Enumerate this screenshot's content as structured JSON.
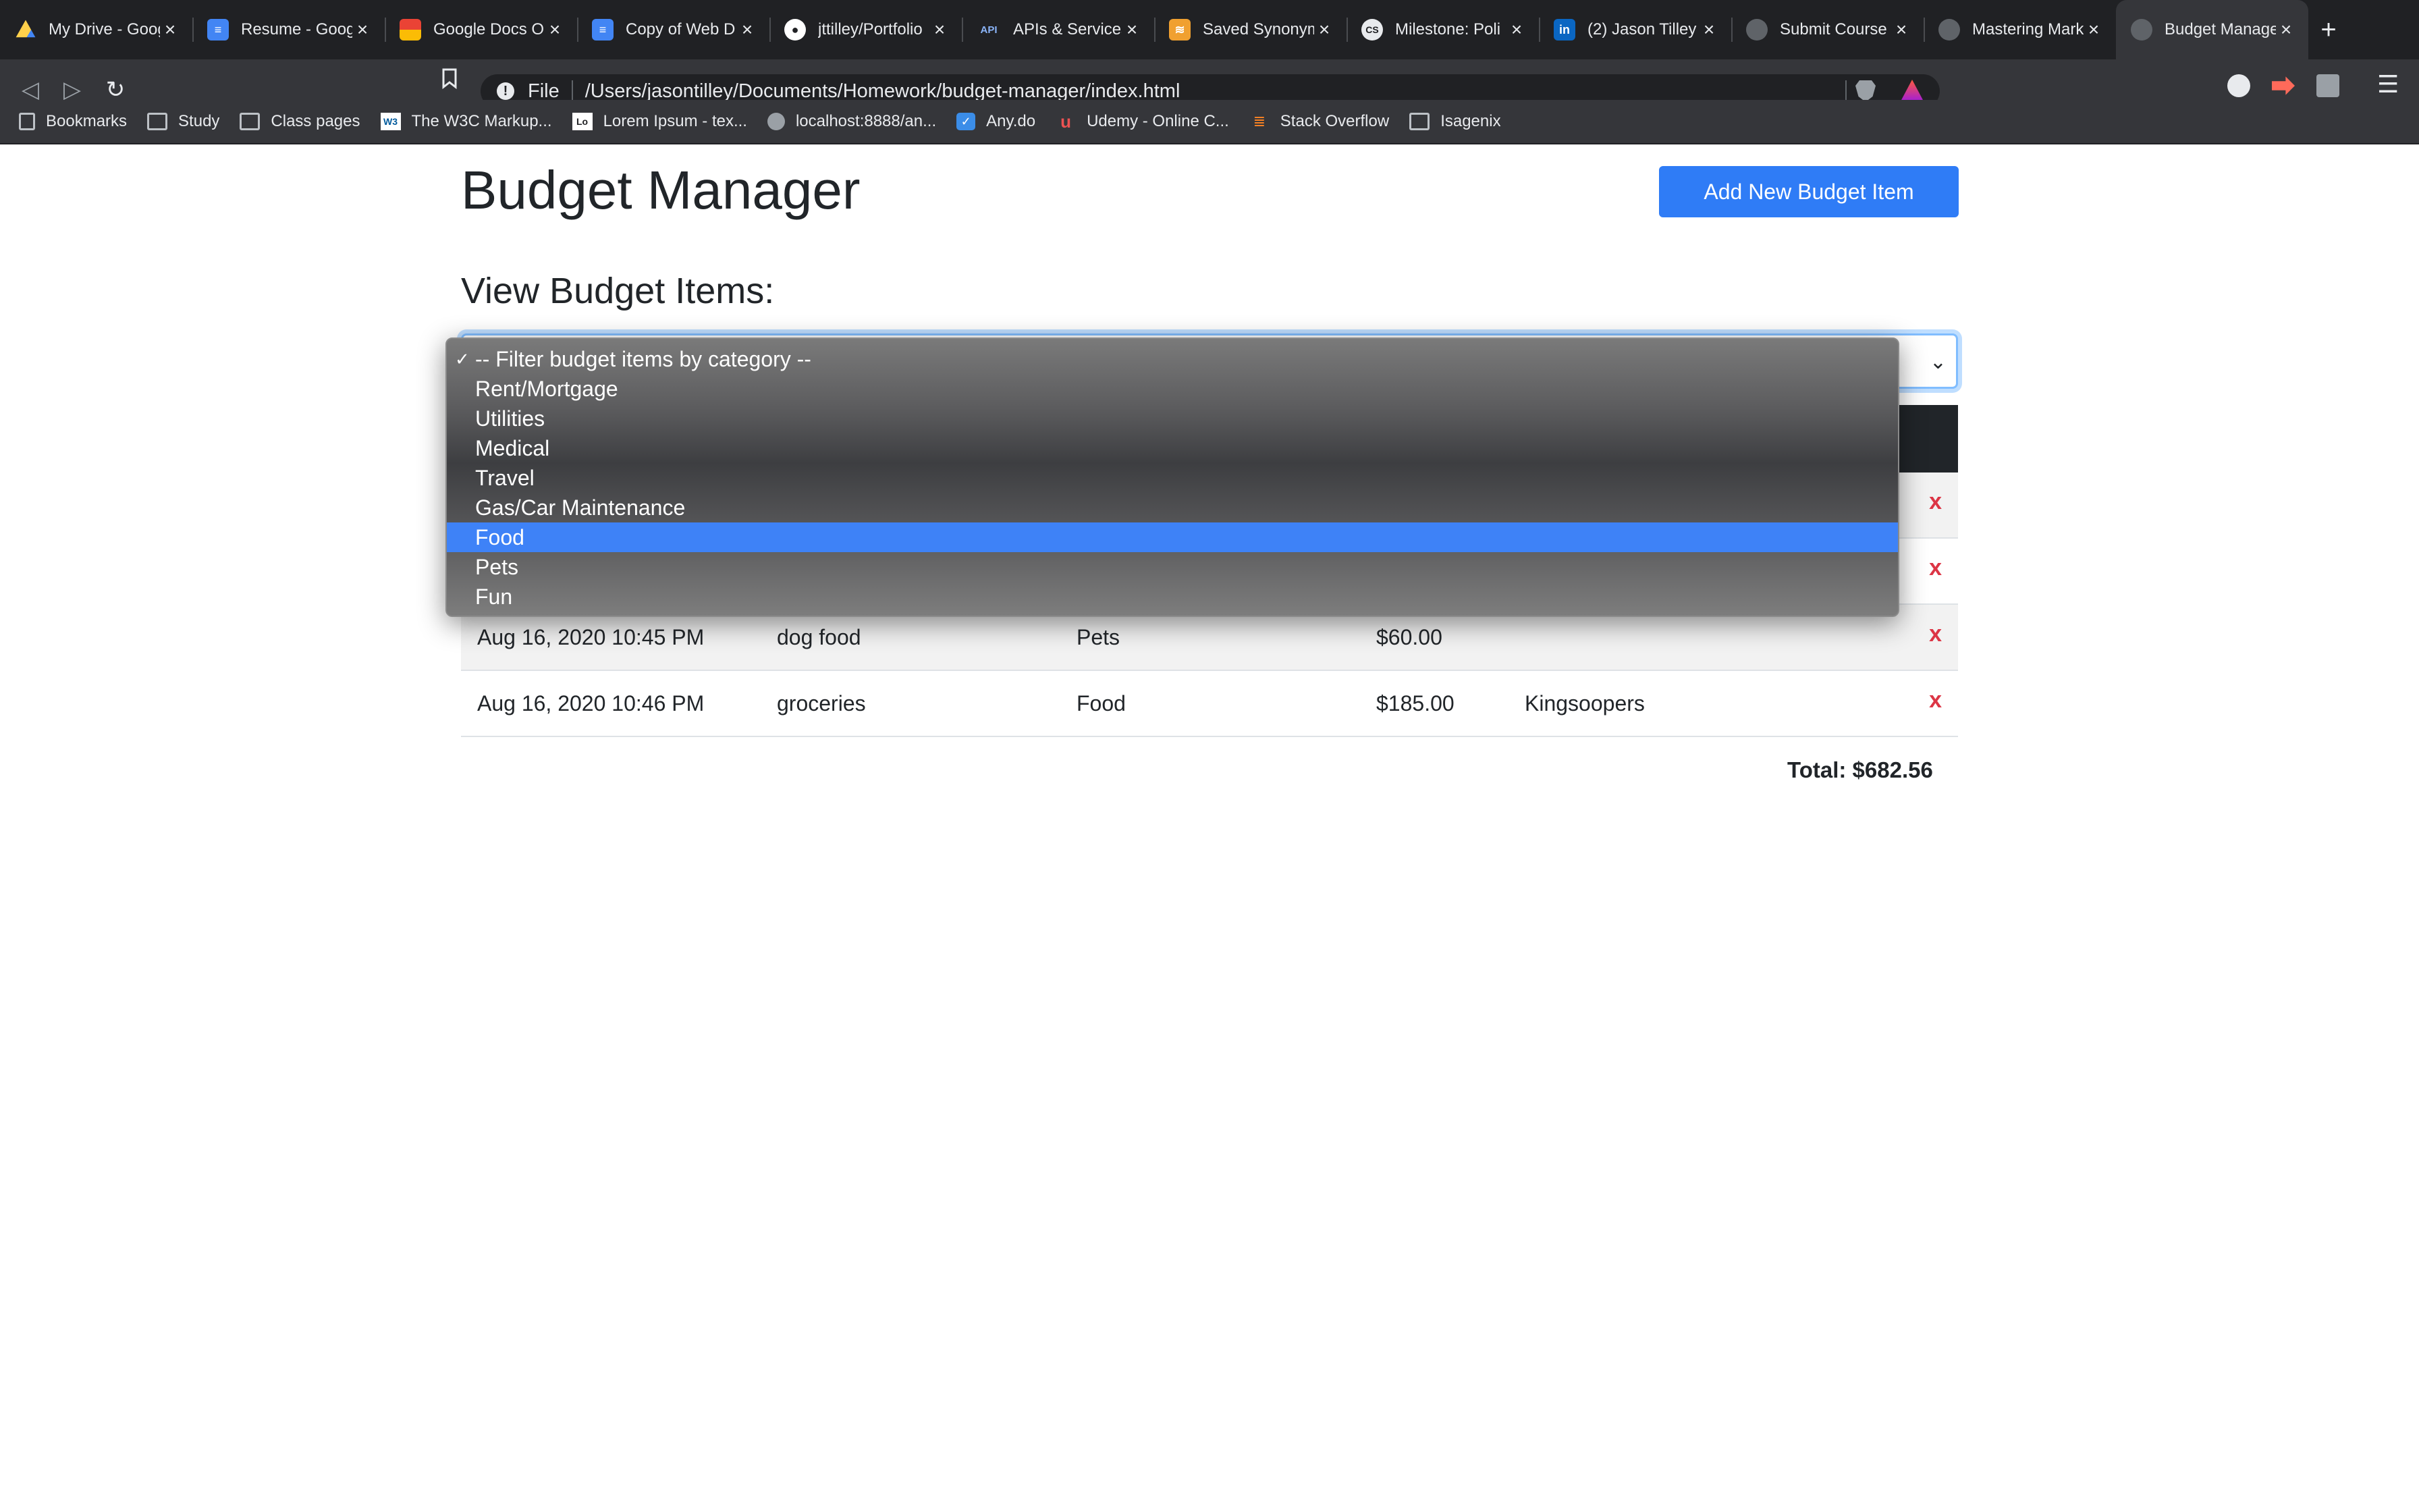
{
  "browser": {
    "tabs": [
      {
        "title": "My Drive - Google Drive",
        "icon": "google-drive-icon",
        "color": "#1fa463"
      },
      {
        "title": "Resume - Google Docs",
        "icon": "google-docs-icon",
        "color": "#4285f4"
      },
      {
        "title": "Google Docs O",
        "icon": "google-docs-offline-icon",
        "color": "#ea4335"
      },
      {
        "title": "Copy of Web D",
        "icon": "google-docs-icon",
        "color": "#4285f4"
      },
      {
        "title": "jttilley/Portfolio",
        "icon": "github-icon",
        "color": "#ffffff"
      },
      {
        "title": "APIs & Services",
        "icon": "api-icon",
        "color": "#8ab4f8"
      },
      {
        "title": "Saved Synonyms",
        "icon": "synonyms-icon",
        "color": "#f0a030"
      },
      {
        "title": "Milestone: Poli",
        "icon": "cs-icon",
        "color": "#e8eaed"
      },
      {
        "title": "(2) Jason Tilley",
        "icon": "linkedin-icon",
        "color": "#0a66c2"
      },
      {
        "title": "Submit Course",
        "icon": "globe-icon",
        "color": "#5f6368"
      },
      {
        "title": "Mastering Mark",
        "icon": "github-icon",
        "color": "#5f6368"
      },
      {
        "title": "Budget Manager",
        "icon": "globe-icon",
        "color": "#5f6368"
      }
    ],
    "active_tab_index": 11,
    "address": {
      "scheme_label": "File",
      "url": "/Users/jasontilley/Documents/Homework/budget-manager/index.html"
    },
    "bookmarks": [
      {
        "label": "Bookmarks",
        "icon": "bookmarks-icon"
      },
      {
        "label": "Study",
        "icon": "folder-icon"
      },
      {
        "label": "Class pages",
        "icon": "folder-icon"
      },
      {
        "label": "The W3C Markup...",
        "icon": "w3c-icon"
      },
      {
        "label": "Lorem Ipsum - tex...",
        "icon": "lorem-ipsum-icon"
      },
      {
        "label": "localhost:8888/an...",
        "icon": "localhost-icon"
      },
      {
        "label": "Any.do",
        "icon": "anydo-icon"
      },
      {
        "label": "Udemy - Online C...",
        "icon": "udemy-icon"
      },
      {
        "label": "Stack Overflow",
        "icon": "stackoverflow-icon"
      },
      {
        "label": "Isagenix",
        "icon": "folder-icon"
      }
    ]
  },
  "app": {
    "title": "Budget Manager",
    "add_button_label": "Add New Budget Item",
    "section_title": "View Budget Items:",
    "filter": {
      "selected": "-- Filter budget items by category --",
      "options": [
        "-- Filter budget items by category --",
        "Rent/Mortgage",
        "Utilities",
        "Medical",
        "Travel",
        "Gas/Car Maintenance",
        "Food",
        "Pets",
        "Fun"
      ],
      "highlighted_option": "Food",
      "checkmark": "✓"
    },
    "rows": [
      {
        "date": "",
        "description": "",
        "category": "",
        "amount": "",
        "notes": "",
        "delete": "x"
      },
      {
        "date": "",
        "description": "",
        "category": "",
        "amount": "",
        "notes": "",
        "delete": "x"
      },
      {
        "date": "Aug 16, 2020 10:45 PM",
        "description": "dog food",
        "category": "Pets",
        "amount": "$60.00",
        "notes": "",
        "delete": "x"
      },
      {
        "date": "Aug 16, 2020 10:46 PM",
        "description": "groceries",
        "category": "Food",
        "amount": "$185.00",
        "notes": "Kingsoopers",
        "delete": "x"
      }
    ],
    "total_label": "Total: $682.56"
  },
  "colors": {
    "primary": "#2f7cf6",
    "danger": "#dc3545",
    "table_header": "#212529",
    "option_highlight": "#3e82f7"
  }
}
